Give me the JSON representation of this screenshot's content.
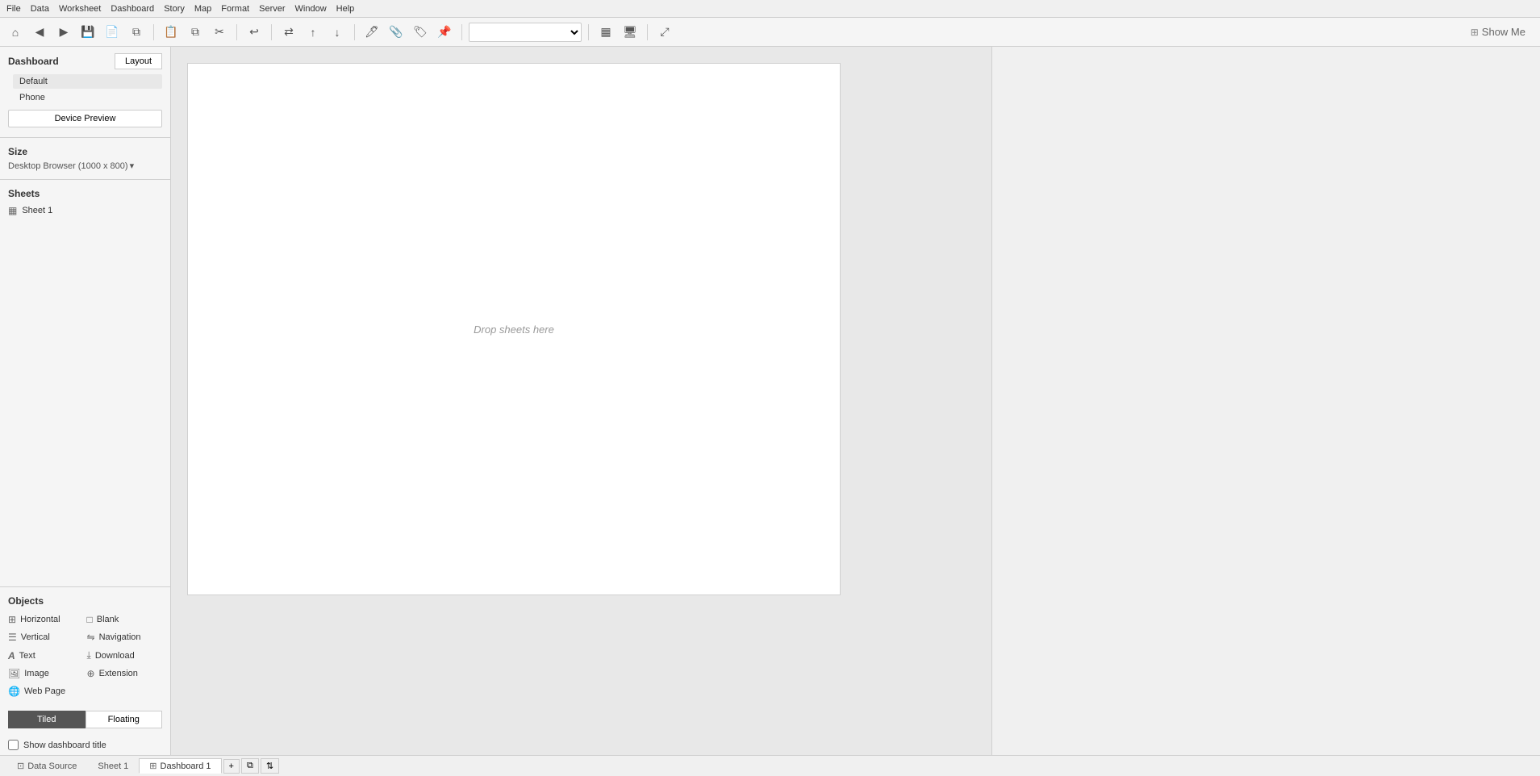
{
  "menubar": {
    "items": [
      "File",
      "Data",
      "Worksheet",
      "Dashboard",
      "Story",
      "Map",
      "Format",
      "Server",
      "Window",
      "Help"
    ]
  },
  "toolbar": {
    "show_me_label": "Show Me",
    "show_me_icon": "⊞",
    "dropdown_placeholder": ""
  },
  "sidebar": {
    "dashboard_label": "Dashboard",
    "layout_label": "Layout",
    "default_item": "Default",
    "phone_item": "Phone",
    "device_preview_btn": "Device Preview",
    "size_label": "Size",
    "size_value": "Desktop Browser (1000 x 800)",
    "size_arrow": "▾",
    "sheets_label": "Sheets",
    "sheet_item": "Sheet 1",
    "objects_label": "Objects",
    "objects": [
      {
        "id": "horizontal",
        "icon": "⊞",
        "label": "Horizontal"
      },
      {
        "id": "blank",
        "icon": "□",
        "label": "Blank"
      },
      {
        "id": "vertical",
        "icon": "⊟",
        "label": "Vertical"
      },
      {
        "id": "navigation",
        "icon": "⇋",
        "label": "Navigation"
      },
      {
        "id": "text",
        "icon": "A",
        "label": "Text"
      },
      {
        "id": "download",
        "icon": "⤓",
        "label": "Download"
      },
      {
        "id": "image",
        "icon": "⊡",
        "label": "Image"
      },
      {
        "id": "extension",
        "icon": "⊕",
        "label": "Extension"
      },
      {
        "id": "webpage",
        "icon": "⊕",
        "label": "Web Page"
      },
      {
        "id": "empty",
        "icon": "",
        "label": ""
      }
    ],
    "tiled_label": "Tiled",
    "floating_label": "Floating",
    "show_dashboard_label": "Show dashboard title"
  },
  "canvas": {
    "drop_hint": "Drop sheets here"
  },
  "statusbar": {
    "data_source_label": "Data Source",
    "sheet1_label": "Sheet 1",
    "dashboard1_label": "Dashboard 1"
  }
}
